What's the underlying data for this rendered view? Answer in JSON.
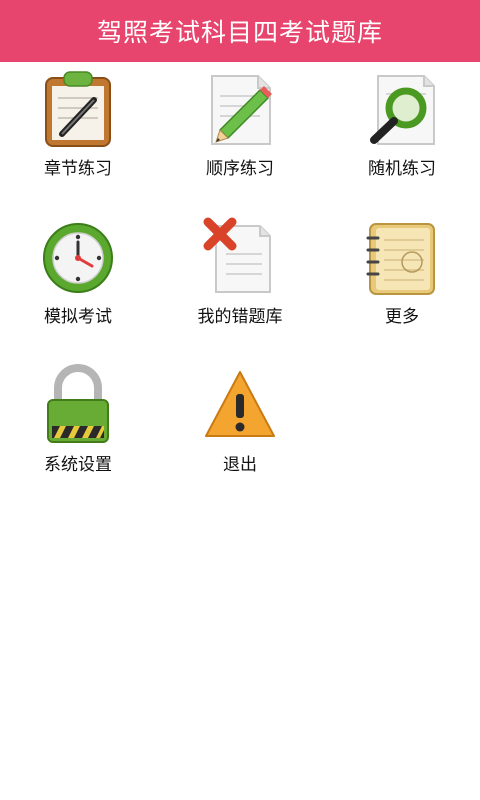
{
  "header": {
    "title": "驾照考试科目四考试题库"
  },
  "menu": [
    {
      "id": "chapter",
      "label": "章节练习",
      "icon": "clipboard-pen-icon"
    },
    {
      "id": "sequential",
      "label": "顺序练习",
      "icon": "paper-pencil-icon"
    },
    {
      "id": "random",
      "label": "随机练习",
      "icon": "magnifier-paper-icon"
    },
    {
      "id": "mock",
      "label": "模拟考试",
      "icon": "clock-icon"
    },
    {
      "id": "mistakes",
      "label": "我的错题库",
      "icon": "paper-cross-icon"
    },
    {
      "id": "more",
      "label": "更多",
      "icon": "notebook-icon"
    },
    {
      "id": "settings",
      "label": "系统设置",
      "icon": "padlock-icon"
    },
    {
      "id": "exit",
      "label": "退出",
      "icon": "warning-icon"
    }
  ],
  "colors": {
    "header": "#e8456e",
    "background": "#ffffff"
  }
}
